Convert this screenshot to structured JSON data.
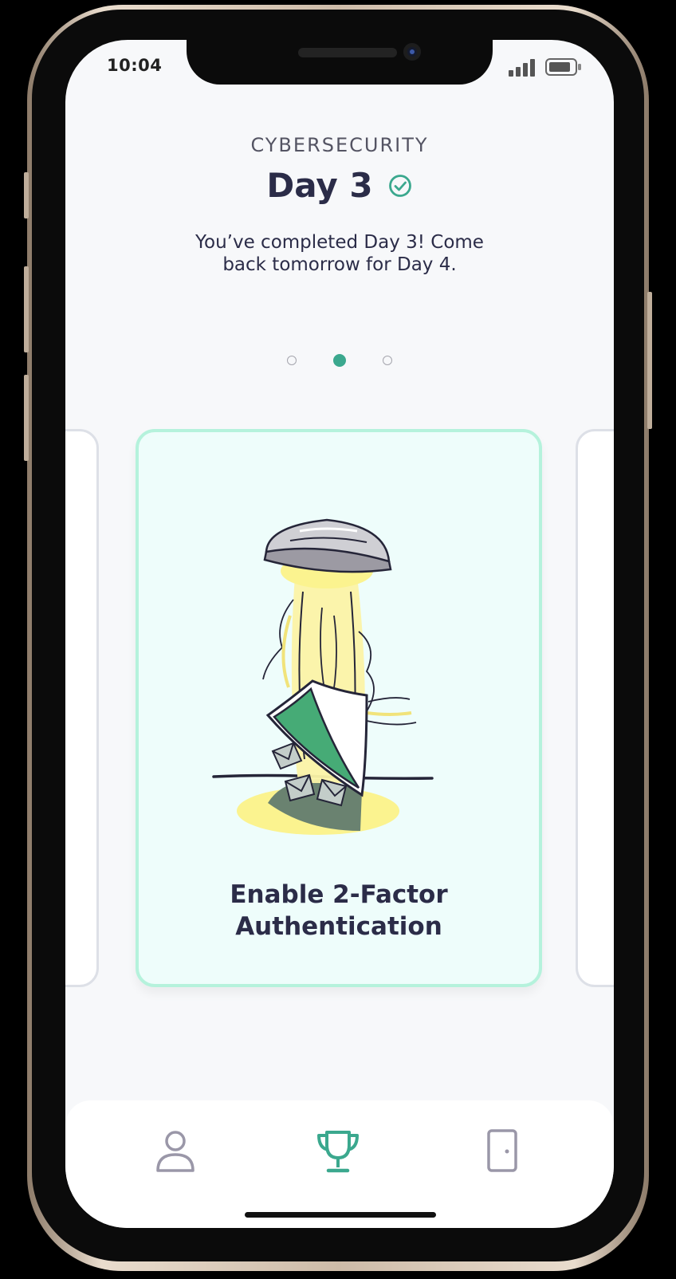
{
  "status_bar": {
    "time": "10:04"
  },
  "header": {
    "course": "CYBERSECURITY",
    "day_title": "Day 3",
    "completion_message": "You’ve completed Day 3! Come back tomorrow for Day 4."
  },
  "pager": {
    "total": 3,
    "active_index": 1
  },
  "card": {
    "title": "Enable 2-Factor Authentication"
  },
  "tab_bar": {
    "items": [
      "profile-icon",
      "trophy-icon",
      "door-icon"
    ],
    "active": "trophy-icon"
  },
  "colors": {
    "accent": "#3ba88e",
    "text_dark": "#2b2c48",
    "card_bg": "#eefdfb",
    "card_border": "#b5f2dc",
    "inactive_icon": "#9a97a8"
  }
}
